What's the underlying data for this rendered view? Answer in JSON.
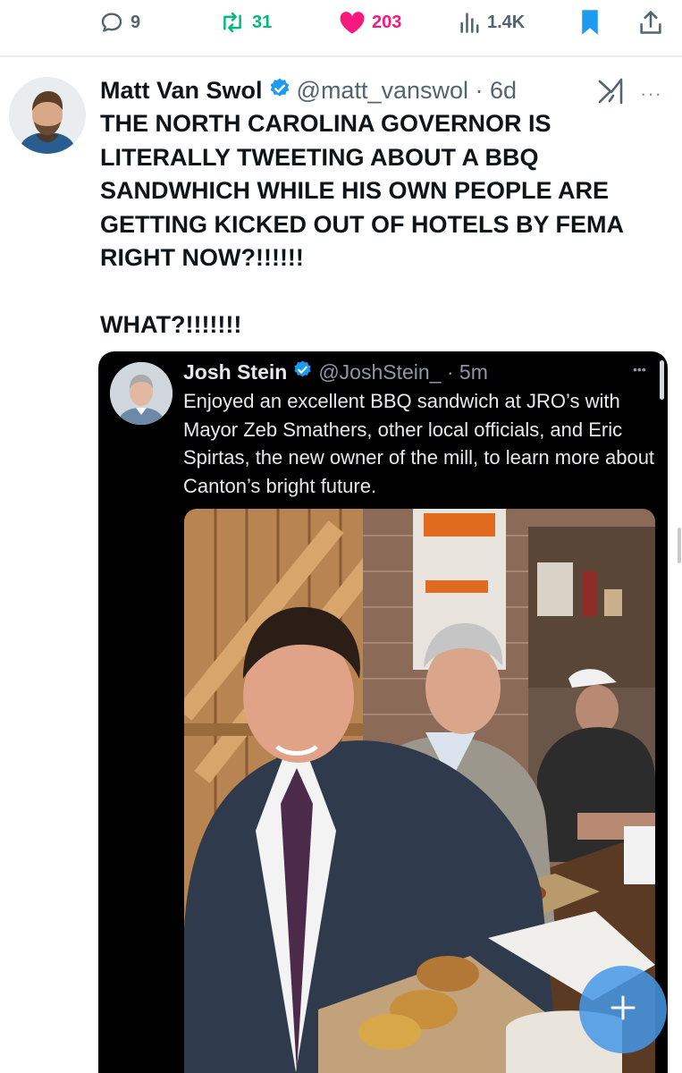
{
  "actions": {
    "replies": "9",
    "reposts": "31",
    "likes": "203",
    "views": "1.4K"
  },
  "colors": {
    "reply": "#536471",
    "repost": "#00ba7c",
    "like": "#f91880",
    "accent": "#1d9bf0",
    "quote_background": "#000000"
  },
  "icons": {
    "reply": "reply-icon",
    "repost": "repost-icon",
    "like": "heart-icon",
    "views": "views-icon",
    "bookmark": "bookmark-icon",
    "share": "share-icon",
    "grok": "grok-icon",
    "more": "more-icon",
    "fab": "plus-icon"
  },
  "tweet": {
    "author_name": "Matt Van Swol",
    "handle_time": "@matt_vanswol · 6d",
    "more": "···",
    "text": "THE NORTH CAROLINA GOVERNOR IS LITERALLY TWEETING ABOUT A BBQ SANDWHICH WHILE HIS OWN PEOPLE ARE GETTING KICKED OUT OF HOTELS BY FEMA RIGHT NOW?!!!!!!\n\nWHAT?!!!!!!!"
  },
  "quote": {
    "author_name": "Josh Stein",
    "handle_time": "@JoshStein_ · 5m",
    "more": "•••",
    "text": "Enjoyed an excellent BBQ sandwich at JRO’s with Mayor Zeb Smathers, other local officials, and Eric Spirtas, the new owner of the mill, to learn more about Canton’s bright future."
  }
}
